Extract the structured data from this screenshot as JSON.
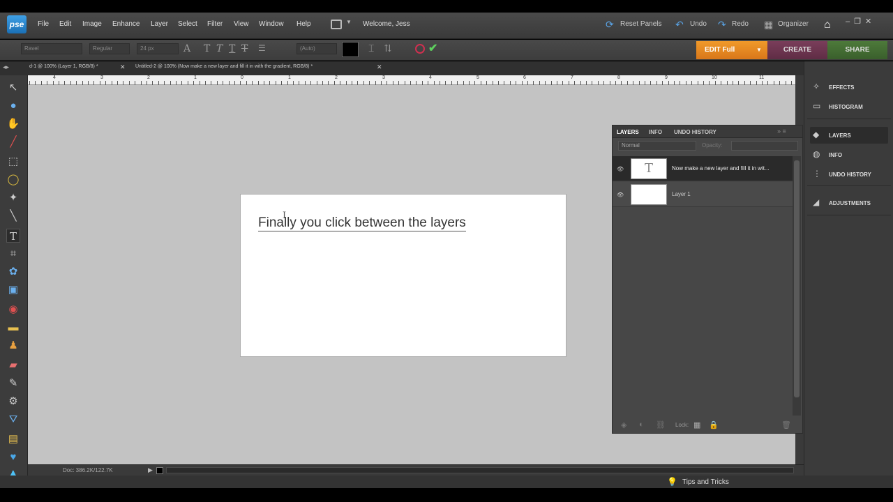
{
  "app": {
    "logo": "pse"
  },
  "menu": [
    "File",
    "Edit",
    "Image",
    "Enhance",
    "Layer",
    "Select",
    "Filter",
    "View",
    "Window",
    "Help"
  ],
  "welcome": "Welcome, Jess",
  "top_actions": {
    "reset_panels": "Reset Panels",
    "undo": "Undo",
    "redo": "Redo",
    "organizer": "Organizer"
  },
  "options": {
    "font_family": "Ravel",
    "font_style": "Regular",
    "font_size": "24 px",
    "leading": "(Auto)",
    "text_color": "#000000"
  },
  "modes": {
    "edit": "EDIT Full",
    "create": "CREATE",
    "share": "SHARE"
  },
  "doc_tabs": [
    {
      "label": "d-1 @ 100% (Layer 1, RGB/8) *"
    },
    {
      "label": "Untitled-2 @ 100% (Now make a new layer and fill it in with the  gradient, RGB/8) *"
    }
  ],
  "ruler_numbers": [
    "4",
    "3",
    "2",
    "1",
    "0",
    "1",
    "2",
    "3",
    "4",
    "5",
    "6",
    "7",
    "8",
    "9",
    "10",
    "11"
  ],
  "document": {
    "text": "Finally you click between the layers"
  },
  "status": {
    "doc_size": "Doc: 386.2K/122.7K"
  },
  "tips": "Tips and Tricks",
  "layers_panel": {
    "tabs": [
      "LAYERS",
      "INFO",
      "UNDO HISTORY"
    ],
    "blend_mode": "Normal",
    "opacity_label": "Opacity:",
    "lock_label": "Lock:",
    "layers": [
      {
        "name": "Now make a new layer and fill it in wit...",
        "thumb": "T",
        "selected": true
      },
      {
        "name": "Layer 1",
        "thumb": "",
        "selected": false
      }
    ]
  },
  "panel_bin": [
    {
      "label": "EFFECTS",
      "icon": "effects-icon"
    },
    {
      "label": "HISTOGRAM",
      "icon": "histogram-icon"
    },
    {
      "label": "LAYERS",
      "icon": "layers-icon"
    },
    {
      "label": "INFO",
      "icon": "info-icon"
    },
    {
      "label": "UNDO HISTORY",
      "icon": "undo-history-icon"
    },
    {
      "label": "ADJUSTMENTS",
      "icon": "adjustments-icon"
    }
  ],
  "colors": {
    "edit_tab": "#e8891f",
    "create_tab": "#6b3550",
    "share_tab": "#446b35",
    "canvas_bg": "#c3c3c3"
  }
}
